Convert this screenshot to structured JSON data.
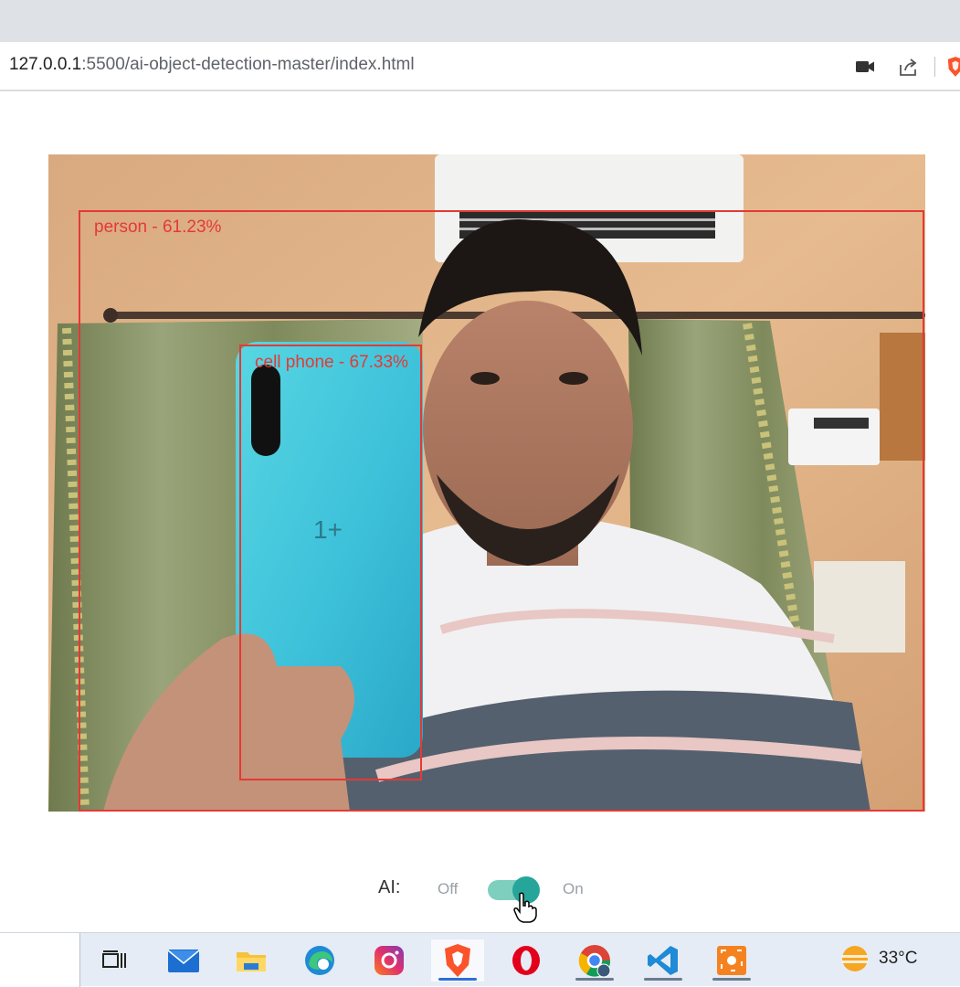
{
  "browser": {
    "url_host": "127.0.0.1",
    "url_rest": ":5500/ai-object-detection-master/index.html",
    "icons": [
      "camera-icon",
      "share-icon",
      "brave-shield-icon"
    ]
  },
  "detections": [
    {
      "label": "person - 61.23%"
    },
    {
      "label": "cell phone - 67.33%"
    }
  ],
  "phone_brand_mark": "1+",
  "ai_control": {
    "label": "AI:",
    "off_label": "Off",
    "on_label": "On",
    "state": "on",
    "accent": "#26a69a"
  },
  "taskbar": {
    "apps": [
      "task-view-icon",
      "mail-icon",
      "file-explorer-icon",
      "edge-icon",
      "instagram-icon",
      "brave-icon",
      "opera-icon",
      "chrome-icon",
      "vscode-icon",
      "screen-recorder-icon"
    ],
    "weather": {
      "temp": "33°C",
      "icon": "weather-sun-icon"
    }
  }
}
